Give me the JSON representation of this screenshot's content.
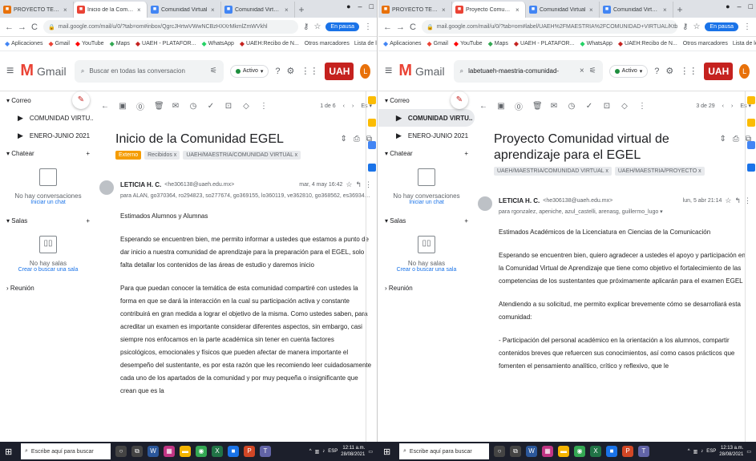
{
  "windows": [
    {
      "tabs": [
        {
          "icon": "project-favicon",
          "color": "#e8710a",
          "title": "PROYECTO TERMINAL - G",
          "active": false
        },
        {
          "icon": "gmail-favicon",
          "color": "#ea4335",
          "title": "Inicio de la Comunidad E",
          "active": true
        },
        {
          "icon": "docs-favicon",
          "color": "#4285f4",
          "title": "Comunidad Virtual",
          "active": false
        },
        {
          "icon": "docs-favicon",
          "color": "#4285f4",
          "title": "Comunidad Virtual - Resu",
          "active": false
        }
      ],
      "url": "mail.google.com/mail/u/0/?tab=om#inbox/QgrcJHrtwVWwNCBzHXXrMkmlZmWVkhl",
      "pause_label": "En pausa",
      "search": {
        "value": "",
        "placeholder": "Buscar en todas las conversacion"
      },
      "active_label": "Activo",
      "sidebar": {
        "mail_title": "Correo",
        "labels": [
          {
            "name": "COMUNIDAD VIRTU..",
            "selected": false
          },
          {
            "name": "ENERO-JUNIO 2021",
            "selected": false
          }
        ],
        "chat_title": "Chatear",
        "chat_empty": "No hay conversaciones",
        "chat_link": "Iniciar un chat",
        "rooms_title": "Salas",
        "rooms_empty": "No hay salas",
        "rooms_link": "Crear o buscar una sala",
        "meet_title": "Reunión"
      },
      "pager": "1 de 6",
      "subject": "Inicio de la Comunidad EGEL",
      "chips": [
        {
          "text": "Externo",
          "ext": true
        },
        {
          "text": "Recibidos x",
          "ext": false
        },
        {
          "text": "UAEH/MAESTRIA/COMUNIDAD VIRTUAL x",
          "ext": false
        }
      ],
      "sender": {
        "name": "LETICIA H. C.",
        "email": "<he306138@uaeh.edu.mx>",
        "date": "mar, 4 may 16:42",
        "to": "para ALAN, go370364, ro294823, so277674, go369155, lo360119, ve362810, go368562, es369347, go369253, j ▾"
      },
      "body": [
        "Estimados Alumnos y Alumnas",
        "Esperando se encuentren bien, me permito informar a ustedes que estamos a punto de dar inicio a nuestra comunidad de aprendizaje para la preparación para el EGEL, solo falta detallar los contenidos de las áreas de estudio y daremos inicio",
        "Para que puedan conocer la temática de esta comunidad compartiré con ustedes la forma en que se dará la interacción en la cual su participación activa y constante contribuirá en gran medida a lograr el objetivo de la misma. Como ustedes saben, para acreditar un examen es importante considerar diferentes aspectos, sin embargo, casi siempre nos enfocamos en la parte académica sin tener en cuenta factores psicológicos, emocionales y físicos que pueden afectar de manera importante el desempeño del sustentante, es por esta razón que les recomiendo leer cuidadosamente cada uno de los apartados de la comunidad y por muy pequeña o insignificante que crean que es la"
      ],
      "taskbar": {
        "search": "Escribe aquí para buscar",
        "lang": "ESP",
        "time": "12:11 a.m.",
        "date": "28/08/2021"
      }
    },
    {
      "tabs": [
        {
          "icon": "project-favicon",
          "color": "#e8710a",
          "title": "PROYECTO TERMINAL - G",
          "active": false
        },
        {
          "icon": "gmail-favicon",
          "color": "#ea4335",
          "title": "Proyecto Comunidad virt",
          "active": true
        },
        {
          "icon": "docs-favicon",
          "color": "#4285f4",
          "title": "Comunidad Virtual",
          "active": false
        },
        {
          "icon": "docs-favicon",
          "color": "#4285f4",
          "title": "Comunidad Virtual - Resu",
          "active": false
        }
      ],
      "url": "mail.google.com/mail/u/0/?tab=om#label/UAEH%2FMAESTRIA%2FCOMUNIDAD+VIRTUAL/KtbxLxgdjRKGnDFTmcNV...",
      "pause_label": "En pausa",
      "search": {
        "value": "labetuaeh-maestria-comunidad-",
        "placeholder": ""
      },
      "active_label": "Activo",
      "sidebar": {
        "mail_title": "Correo",
        "labels": [
          {
            "name": "COMUNIDAD VIRTU..",
            "selected": true
          },
          {
            "name": "ENERO-JUNIO 2021",
            "selected": false
          }
        ],
        "chat_title": "Chatear",
        "chat_empty": "No hay conversaciones",
        "chat_link": "Iniciar un chat",
        "rooms_title": "Salas",
        "rooms_empty": "No hay salas",
        "rooms_link": "Crear o buscar una sala",
        "meet_title": "Reunión"
      },
      "pager": "3 de 29",
      "subject": "Proyecto Comunidad virtual de aprendizaje para el EGEL",
      "chips": [
        {
          "text": "UAEH/MAESTRIA/COMUNIDAD VIRTUAL x",
          "ext": false
        },
        {
          "text": "UAEH/MAESTRIA/PROYECTO x",
          "ext": false
        }
      ],
      "sender": {
        "name": "LETICIA H. C.",
        "email": "<he306138@uaeh.edu.mx>",
        "date": "lun, 5 abr 21:14",
        "to": "para rgonzalez, apeniche, azul_castelli, arenasg, guillermo_lugo ▾"
      },
      "body": [
        "Estimados Académicos de la Licenciatura en Ciencias de la Comunicación",
        "Esperando se encuentren bien, quiero agradecer a ustedes el apoyo y participación en la Comunidad Virtual de Aprendizaje que tiene como objetivo el fortalecimiento de las competencias de los sustentantes que próximamente aplicarán para el examen EGEL",
        "Atendiendo a su solicitud, me permito explicar brevemente cómo se desarrollará esta comunidad:",
        "- Participación del personal académico en la orientación a los alumnos, compartir contenidos breves que refuercen sus conocimientos, así como casos prácticos que fomenten el pensamiento analítico, crítico y reflexivo, que le"
      ],
      "taskbar": {
        "search": "Escribe aquí para buscar",
        "lang": "ESP",
        "time": "12:13 a.m.",
        "date": "28/08/2021"
      }
    }
  ],
  "bookmarks": [
    {
      "icon": "apps-icon",
      "label": "Aplicaciones",
      "color": "#4285f4"
    },
    {
      "icon": "gmail-icon",
      "label": "Gmail",
      "color": "#ea4335"
    },
    {
      "icon": "youtube-icon",
      "label": "YouTube",
      "color": "#ff0000"
    },
    {
      "icon": "maps-icon",
      "label": "Maps",
      "color": "#34a853"
    },
    {
      "icon": "uaeh-icon",
      "label": "UAEH - PLATAFOR...",
      "color": "#c5221f"
    },
    {
      "icon": "whatsapp-icon",
      "label": "WhatsApp",
      "color": "#25d366"
    },
    {
      "icon": "uaeh-icon",
      "label": "UAEH:Recibo de N...",
      "color": "#c5221f"
    }
  ],
  "bookmarks_right": [
    "Otros marcadores",
    "Lista de lectura"
  ],
  "brand": {
    "gmail_text": "Gmail",
    "uah_text": "UAH",
    "avatar_initial": "L",
    "colors": {
      "gmail_red": "#ea4335",
      "uaeh": "#c5221f",
      "chip_external": "#f59c00",
      "active": "#1e8e3e",
      "link": "#1a73e8"
    }
  }
}
